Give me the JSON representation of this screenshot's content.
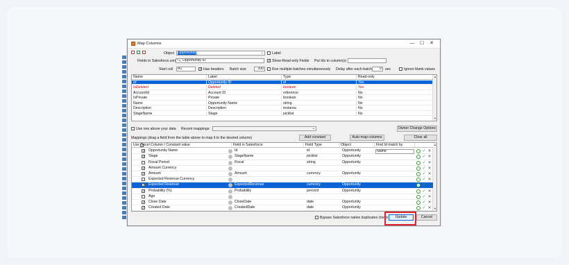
{
  "window": {
    "title": "Map Columns",
    "min": "—",
    "max": "☐",
    "close": "✕"
  },
  "top": {
    "object_label": "Object",
    "object_value": "Opportunity",
    "label_check": "Label",
    "fields_label": "Fields in Salesforce.com",
    "search_value": "Opportunity ID",
    "show_readonly": "Show Read-only Fields",
    "put_ids_label": "Put Ids to column(s)",
    "start_cell_label": "Start cell",
    "start_cell_value": "A1",
    "has_headers": "Has headers",
    "batch_size_label": "Batch size",
    "batch_size_value": "200",
    "run_multiple": "Run multiple batches simultaneously",
    "delay_label": "Delay after each batch",
    "delay_value": "0",
    "delay_unit": "sec",
    "ignore_blank": "Ignore blank values"
  },
  "fields_grid": {
    "headers": [
      "Name",
      "Label",
      "Type",
      "Read-only"
    ],
    "rows": [
      [
        "Id",
        "Opportunity ID",
        "id",
        "Yes"
      ],
      [
        "IsDeleted",
        "Deleted",
        "boolean",
        "Yes"
      ],
      [
        "AccountId",
        "Account ID",
        "reference",
        "No"
      ],
      [
        "IsPrivate",
        "Private",
        "boolean",
        "No"
      ],
      [
        "Name",
        "Opportunity Name",
        "string",
        "No"
      ],
      [
        "Description",
        "Description",
        "textarea",
        "No"
      ],
      [
        "StageName",
        "Stage",
        "picklist",
        "No"
      ]
    ]
  },
  "mid": {
    "use_row_above": "Use row above your data",
    "recent_mappings": "Recent mappings:",
    "owner_change": "Owner Change Options",
    "mappings_hint": "Mappings (drag a field from the table above to map it to the desired column)",
    "add_constant": "Add constant",
    "auto_map": "Auto-map columns",
    "clear_all": "Clear all"
  },
  "mapping_grid": {
    "headers": [
      "Use",
      "Excel Column / Constant value",
      "Field in Salesforce",
      "Field Type",
      "Object",
      "Find Id match by"
    ],
    "rows": [
      {
        "use": true,
        "excel": "Opportunity Name",
        "field": "Id",
        "type": "id",
        "object": "Opportunity",
        "match": "Name"
      },
      {
        "use": true,
        "excel": "Stage",
        "field": "StageName",
        "type": "picklist",
        "object": "Opportunity",
        "match": ""
      },
      {
        "use": false,
        "excel": "Fiscal Period",
        "field": "Fiscal",
        "type": "string",
        "object": "Opportunity",
        "match": ""
      },
      {
        "use": true,
        "excel": "Amount Currency",
        "field": "",
        "type": "",
        "object": "",
        "match": ""
      },
      {
        "use": true,
        "excel": "Amount",
        "field": "Amount",
        "type": "currency",
        "object": "Opportunity",
        "match": ""
      },
      {
        "use": false,
        "excel": "Expected Revenue Currency",
        "field": "",
        "type": "",
        "object": "",
        "match": ""
      },
      {
        "use": true,
        "excel": "Expected Revenue",
        "field": "ExpectedRevenue",
        "type": "currency",
        "object": "Opportunity",
        "match": ""
      },
      {
        "use": true,
        "excel": "Probability (%)",
        "field": "Probability",
        "type": "percent",
        "object": "Opportunity",
        "match": ""
      },
      {
        "use": false,
        "excel": "Age",
        "field": "",
        "type": "",
        "object": "",
        "match": ""
      },
      {
        "use": true,
        "excel": "Close Date",
        "field": "CloseDate",
        "type": "date",
        "object": "Opportunity",
        "match": ""
      },
      {
        "use": true,
        "excel": "Created Date",
        "field": "CreatedDate",
        "type": "date",
        "object": "Opportunity",
        "match": ""
      }
    ]
  },
  "bottom": {
    "bypass": "Bypass Salesforce native duplicates check",
    "update": "Update",
    "cancel": "Cancel"
  }
}
